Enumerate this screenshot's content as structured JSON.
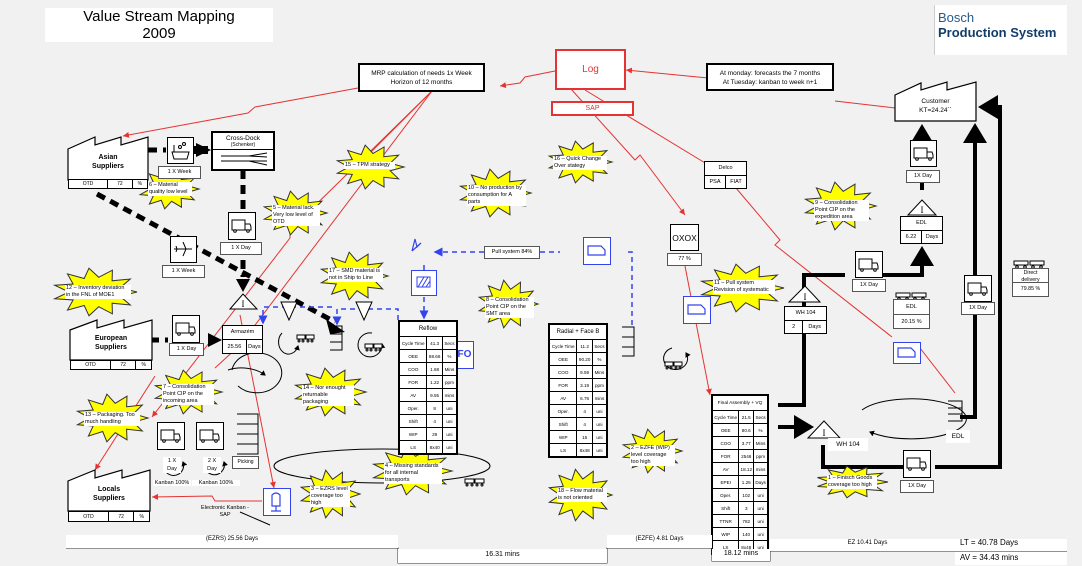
{
  "header": {
    "title_line1": "Value Stream Mapping",
    "title_line2": "2009",
    "brand_line1": "Bosch",
    "brand_line2": "Production System"
  },
  "info_flow": {
    "mrp_line1": "MRP calculation of needs 1x Week",
    "mrp_line2": "Horizon of 12 months",
    "log": "Log",
    "sap": "SAP",
    "forecast_line1": "At monday: forecasts the 7 months",
    "forecast_line2": "At Tuesday: kanban to week n+1",
    "oxox": "OXOX",
    "oxox_value": "77 %",
    "pull_system": "Pull system 84%",
    "electronic_kanban_line1": "Electronic Kanban -",
    "electronic_kanban_line2": "SAP",
    "fifo": "FIFO"
  },
  "suppliers": {
    "asian": {
      "name_line1": "Asian",
      "name_line2": "Suppliers",
      "otd_label": "OTD",
      "otd_value": "72",
      "otd_unit": "%"
    },
    "european": {
      "name_line1": "European",
      "name_line2": "Suppliers",
      "otd_label": "OTD",
      "otd_value": "72",
      "otd_unit": "%"
    },
    "locals": {
      "name_line1": "Locals",
      "name_line2": "Suppliers",
      "otd_label": "OTD",
      "otd_value": "72",
      "otd_unit": "%"
    }
  },
  "customer": {
    "name": "Customer",
    "takt": "KT=24.24´´",
    "delco": {
      "title": "Delco",
      "c1": "PSA",
      "c2": "FIAT"
    }
  },
  "logistics": {
    "cross_dock_line1": "Cross-Dock",
    "cross_dock_line2": "(Schenker)",
    "asian_ship_freq": "1 X Week",
    "air_freq": "1 X Week",
    "truck_to_armazem": "1 X Day",
    "european_freq": "1 X Day",
    "local_1": "1 X Day",
    "local_2": "2 X Day",
    "kanban_1": "Kanban 100%",
    "kanban_2": "Kanban 100%",
    "picking": "Picking",
    "customer_truck_freq": "1X Day",
    "edl_truck_freq": "1X Day",
    "right_truck_freq": "1X Day",
    "bottom_truck_freq": "1X Day",
    "edl_pct_label": "EDL",
    "edl_pct_value": "20.15 %",
    "direct_delivery_line1": "Direct",
    "direct_delivery_line2": "delivery",
    "direct_delivery_value": "79.85 %",
    "edl_label": "EDL"
  },
  "inventories": {
    "armazem": {
      "name": "Armazém",
      "value": "25.56",
      "unit": "Days"
    },
    "wh104_top": {
      "name": "WH 104",
      "value": "2",
      "unit": "Days"
    },
    "edl": {
      "name": "EDL",
      "value": "6.22",
      "unit": "Days"
    },
    "wh104_bottom": {
      "name": "WH 104"
    }
  },
  "processes": [
    {
      "name": "Reflow",
      "rows": [
        [
          "Cycle Time",
          "41.3",
          "Secs"
        ],
        [
          "OEE",
          "88.66",
          "%"
        ],
        [
          "COO",
          "1.68",
          "Mins"
        ],
        [
          "FOR",
          "1.22",
          "ppm"
        ],
        [
          "AV",
          "9.55",
          "mins"
        ],
        [
          "Oper.",
          "8",
          "uni"
        ],
        [
          "Shift",
          "4",
          "uni"
        ],
        [
          "WIP",
          "29",
          "uni"
        ],
        [
          "LS",
          "8x40",
          "uni"
        ]
      ]
    },
    {
      "name": "Radial + Face B",
      "rows": [
        [
          "Cycle Time",
          "11.2",
          "Secs"
        ],
        [
          "OEE",
          "90.20",
          "%"
        ],
        [
          "COO",
          "9.59",
          "Mins"
        ],
        [
          "FOR",
          "3.19",
          "ppm"
        ],
        [
          "AV",
          "6.76",
          "mins"
        ],
        [
          "Oper.",
          "4",
          "uni"
        ],
        [
          "Shift",
          "4",
          "uni"
        ],
        [
          "WIP",
          "15",
          "uni"
        ],
        [
          "LS",
          "8x48",
          "uni"
        ]
      ]
    },
    {
      "name": "Final Assembly + VQ",
      "rows": [
        [
          "Cycle Time",
          "21.5",
          "Secs"
        ],
        [
          "OEE",
          "80.6",
          "%"
        ],
        [
          "COO",
          "3.77",
          "Mins"
        ],
        [
          "FOR",
          "2546",
          "ppm"
        ],
        [
          "AV",
          "18.12",
          "mins"
        ],
        [
          "EPEI",
          "1.25",
          "Days"
        ],
        [
          "Oper.",
          "102",
          "uni"
        ],
        [
          "Shift",
          "3",
          "uni"
        ],
        [
          "TTNR",
          "782",
          "uni"
        ],
        [
          "WIP",
          "140",
          "uni"
        ],
        [
          "LS",
          "8x48",
          "uni"
        ]
      ]
    }
  ],
  "kaizen_bursts": [
    {
      "id": "15",
      "text": "15 – TPM strategy"
    },
    {
      "id": "16",
      "text": "16 – Quick Change Over stategy"
    },
    {
      "id": "10",
      "text": "10 – No production by consumption for A parts"
    },
    {
      "id": "6",
      "text": "6 – Material quality low level"
    },
    {
      "id": "5",
      "text": "5 – Material lack. Very low level of OTD"
    },
    {
      "id": "12",
      "text": "12 – Inventory deviation in the FNL of MOE1"
    },
    {
      "id": "17",
      "text": "17 – SMD material is not in Ship to Line"
    },
    {
      "id": "8",
      "text": "8 – Consolidation Point CIP on the SMT area"
    },
    {
      "id": "9",
      "text": "9 – Consolidation Point CIP on the expedition area"
    },
    {
      "id": "11",
      "text": "11 – Pull system Revision of systematic"
    },
    {
      "id": "7",
      "text": "7 – Consolidation Point CIP on the incoming area"
    },
    {
      "id": "14",
      "text": "14 – Nor enought returnable packaging"
    },
    {
      "id": "13",
      "text": "13 – Packaging. Too much handling"
    },
    {
      "id": "3",
      "text": "3 – EZRS level coverage too high"
    },
    {
      "id": "4",
      "text": "4 – Missing standards for all internal transports"
    },
    {
      "id": "18",
      "text": "18 – Flow material is not oriented"
    },
    {
      "id": "2",
      "text": "2 – EZFE (WIP) level coverage too high"
    },
    {
      "id": "1",
      "text": "1 – Finisch Goods coverage too high"
    }
  ],
  "timeline": {
    "ezrs": "(EZRS)  25.56 Days",
    "va1": "16.31 mins",
    "ezfe": "(EZFE)  4.81 Days",
    "va2": "18.12 mins",
    "ez": "EZ   10.41 Days",
    "lt": "LT =   40.78 Days",
    "av": "AV =  34.43 mins"
  }
}
